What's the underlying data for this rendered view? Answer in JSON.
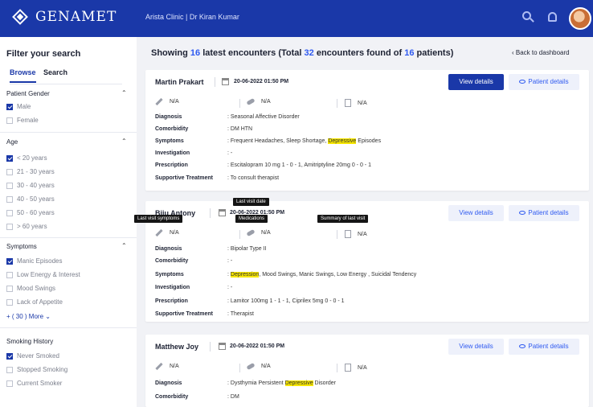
{
  "brand": {
    "name": "GENAMET"
  },
  "header": {
    "clinic": "Arista Clinic  |  Dr Kiran Kumar"
  },
  "sidebar": {
    "title": "Filter your search",
    "tabs": [
      "Browse",
      "Search"
    ],
    "sections": {
      "gender": {
        "title": "Patient Gender",
        "options": [
          {
            "label": "Male",
            "checked": true
          },
          {
            "label": "Female",
            "checked": false
          }
        ]
      },
      "age": {
        "title": "Age",
        "options": [
          {
            "label": "< 20 years",
            "checked": true
          },
          {
            "label": "21 - 30 years",
            "checked": false
          },
          {
            "label": "30 - 40 years",
            "checked": false
          },
          {
            "label": "40 - 50 years",
            "checked": false
          },
          {
            "label": "50 - 60 years",
            "checked": false
          },
          {
            "label": "> 60 years",
            "checked": false
          }
        ]
      },
      "symptoms": {
        "title": "Symptoms",
        "options": [
          {
            "label": "Manic Episodes",
            "checked": true
          },
          {
            "label": "Low Energy & Interest",
            "checked": false
          },
          {
            "label": "Mood Swings",
            "checked": false
          },
          {
            "label": "Lack of Appetite",
            "checked": false
          }
        ],
        "more": "+ ( 30 ) More"
      },
      "smoking": {
        "title": "Smoking History",
        "options": [
          {
            "label": "Never Smoked",
            "checked": true
          },
          {
            "label": "Stopped Smoking",
            "checked": false
          },
          {
            "label": "Current Smoker",
            "checked": false
          }
        ]
      }
    }
  },
  "main": {
    "heading_prefix": "Showing ",
    "latest_count": "16",
    "heading_mid": " latest encounters (Total ",
    "total_count": "32",
    "heading_mid2": " encounters found of ",
    "patient_count": "16",
    "heading_suffix": " patients)",
    "back": "‹ Back to dashboard",
    "labels": {
      "diagnosis": "Diagnosis",
      "comorbidity": "Comorbidity",
      "symptoms": "Symptoms",
      "investigation": "Investigation",
      "prescription": "Prescription",
      "supportive": "Supportive Treatment"
    },
    "buttons": {
      "view": "View details",
      "patient": "Patient details"
    },
    "na": "N/A",
    "cards": [
      {
        "name": "Martin Prakart",
        "date": "20-06-2022 01:50 PM",
        "diagnosis": ": Seasonal Affective Disorder",
        "comorbidity": ": DM HTN",
        "symptoms_pre": ": Frequent Headaches, Sleep Shortage, ",
        "symptoms_hl": "Depressive",
        "symptoms_post": " Episodes",
        "investigation": ": -",
        "prescription": ": Escitalopram 10 mg  1 - 0 - 1, Amitriptyline 20mg 0 - 0 - 1",
        "supportive": ": To consult therapist"
      },
      {
        "name": "Biju Antony",
        "date": "20-06-2022 01:50 PM",
        "diagnosis": ": Bipolar Type II",
        "comorbidity": ": -",
        "symptoms_pre": ": ",
        "symptoms_hl": "Depression",
        "symptoms_post": ", Mood Swings, Manic Swings, Low Energy , Suicidal Tendency",
        "investigation": ": -",
        "prescription": ": Lamitor 100mg  1 - 1 - 1,  Ciprilex 5mg  0 - 0 - 1",
        "supportive": ": Therapist"
      },
      {
        "name": "Matthew Joy",
        "date": "20-06-2022 01:50 PM",
        "diagnosis_pre": ": Dysthymia Persistent ",
        "diagnosis_hl": "Depressive",
        "diagnosis_post": " Disorder",
        "comorbidity": ": DM"
      }
    ],
    "tooltips": {
      "last_visit_date": "Last visit date",
      "last_visit_symptoms": "Last visit symptoms",
      "medications": "Medications",
      "summary": "Summary of last visit"
    }
  },
  "colors": {
    "primary": "#1a38a8",
    "accent": "#2f5af0",
    "highlight": "#f6e600"
  }
}
